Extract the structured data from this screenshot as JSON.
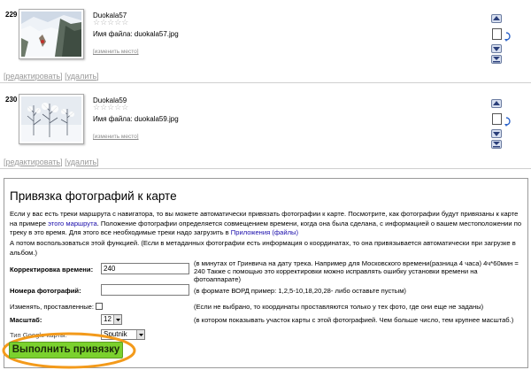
{
  "photos": [
    {
      "num": "229",
      "name": "Duokala57",
      "stars": "☆☆☆☆☆",
      "filename": "Имя файла: duokala57.jpg",
      "change_place": "[изменить место]",
      "links": {
        "open": "[",
        "edit": "редактировать",
        "mid": "] [",
        "delete": "удалить",
        "close": "]"
      }
    },
    {
      "num": "230",
      "name": "Duokala59",
      "stars": "☆☆☆☆☆",
      "filename": "Имя файла: duokala59.jpg",
      "change_place": "[изменить место]",
      "links": {
        "open": "[",
        "edit": "редактировать",
        "mid": "] [",
        "delete": "удалить",
        "close": "]"
      }
    }
  ],
  "binding": {
    "title": "Привязка фотографий к карте",
    "intro_1": "Если у вас есть треки маршрута с навигатора, то вы можете автоматически привязать фотографии к карте. Посмотрите, как фотографии будут привязаны к карте на примере",
    "intro_link": "этого маршрута",
    "intro_2": ". Положение фотографии определяется совмещением времени, когда она была сделана, с информацией о вашем местоположении по треку в это время. Для этого все необходимые треки надо загрузить в",
    "intro_link2": "Приложения (файлы)",
    "intro_3": "А потом воспользоваться этой функцией. (Если в метаданных фотографии есть информация о координатах, то она привязывается автоматически при загрузке в альбом.)",
    "time_label": "Корректировка времени:",
    "time_value": "240",
    "time_hint": "(в минутах от Гринвича на дату трека. Например для Московского времени(разница 4 часа) 4ч*60мин = 240 Также с помощью это корректировки можно исправлять ошибку установки времени на фотоаппарате)",
    "numbers_label": "Номера фотографий:",
    "numbers_value": "",
    "numbers_hint": "(в формате ВОРД пример: 1,2,5-10,18,20,28- либо оставьте пустым)",
    "change_label": "Изменять, проставленные:",
    "change_hint": "(Если не выбрано, то координаты проставляются только у тех фото, где они еще не заданы)",
    "scale_label": "Масштаб:",
    "scale_value": "12",
    "scale_hint": "(в котором показывать участок карты с этой фотографией. Чем больше число, тем крупнее масштаб.)",
    "maptype_label": "Тип Google-карты:",
    "maptype_value": "Sputnik",
    "run_label": "Выполнить привязку"
  },
  "colors": {
    "run_button": "#7bd12e",
    "highlight_oval": "#f39a1b",
    "link": "#1a0dab"
  },
  "icons": [
    "move-up-icon",
    "select-checkbox",
    "rotate-icon",
    "move-down-icon",
    "move-last-icon",
    "dropdown-arrow-icon"
  ]
}
